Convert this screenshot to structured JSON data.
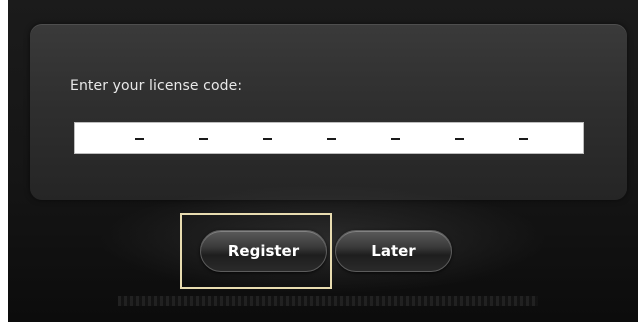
{
  "dialog": {
    "prompt": "Enter your license code:",
    "license_code": {
      "segments": 7,
      "separator": "–"
    }
  },
  "buttons": {
    "register_label": "Register",
    "later_label": "Later"
  },
  "colors": {
    "focus_frame": "#e8dcb0",
    "panel": "#2f2f2f",
    "background": "#151515"
  }
}
